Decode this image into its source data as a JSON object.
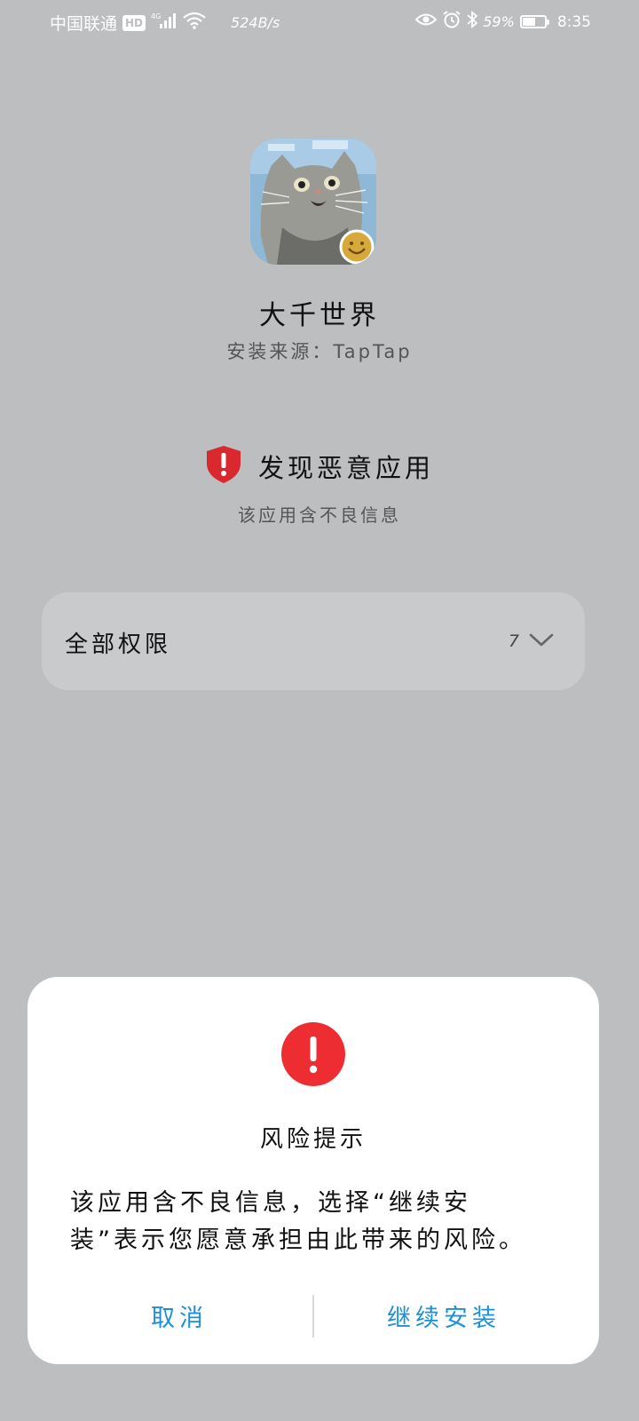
{
  "status_bar": {
    "carrier": "中国联通",
    "hd_badge": "HD",
    "network_type": "4G",
    "net_speed": "524B/s",
    "battery_percent": "59%",
    "battery_level": 0.59,
    "time": "8:35"
  },
  "app": {
    "name": "大千世界",
    "source": "安装来源：TapTap"
  },
  "warning": {
    "title": "发现恶意应用",
    "subtitle": "该应用含不良信息",
    "color": "#d9282e"
  },
  "permissions": {
    "label": "全部权限",
    "count": "7"
  },
  "dialog": {
    "title": "风险提示",
    "line1": "该应用含不良信息，选择“继续安",
    "line2": "装”表示您愿意承担由此带来的风险。",
    "cancel_label": "取消",
    "continue_label": "继续安装",
    "accent": "#1b90d8",
    "alert_color": "#ee2d32"
  }
}
